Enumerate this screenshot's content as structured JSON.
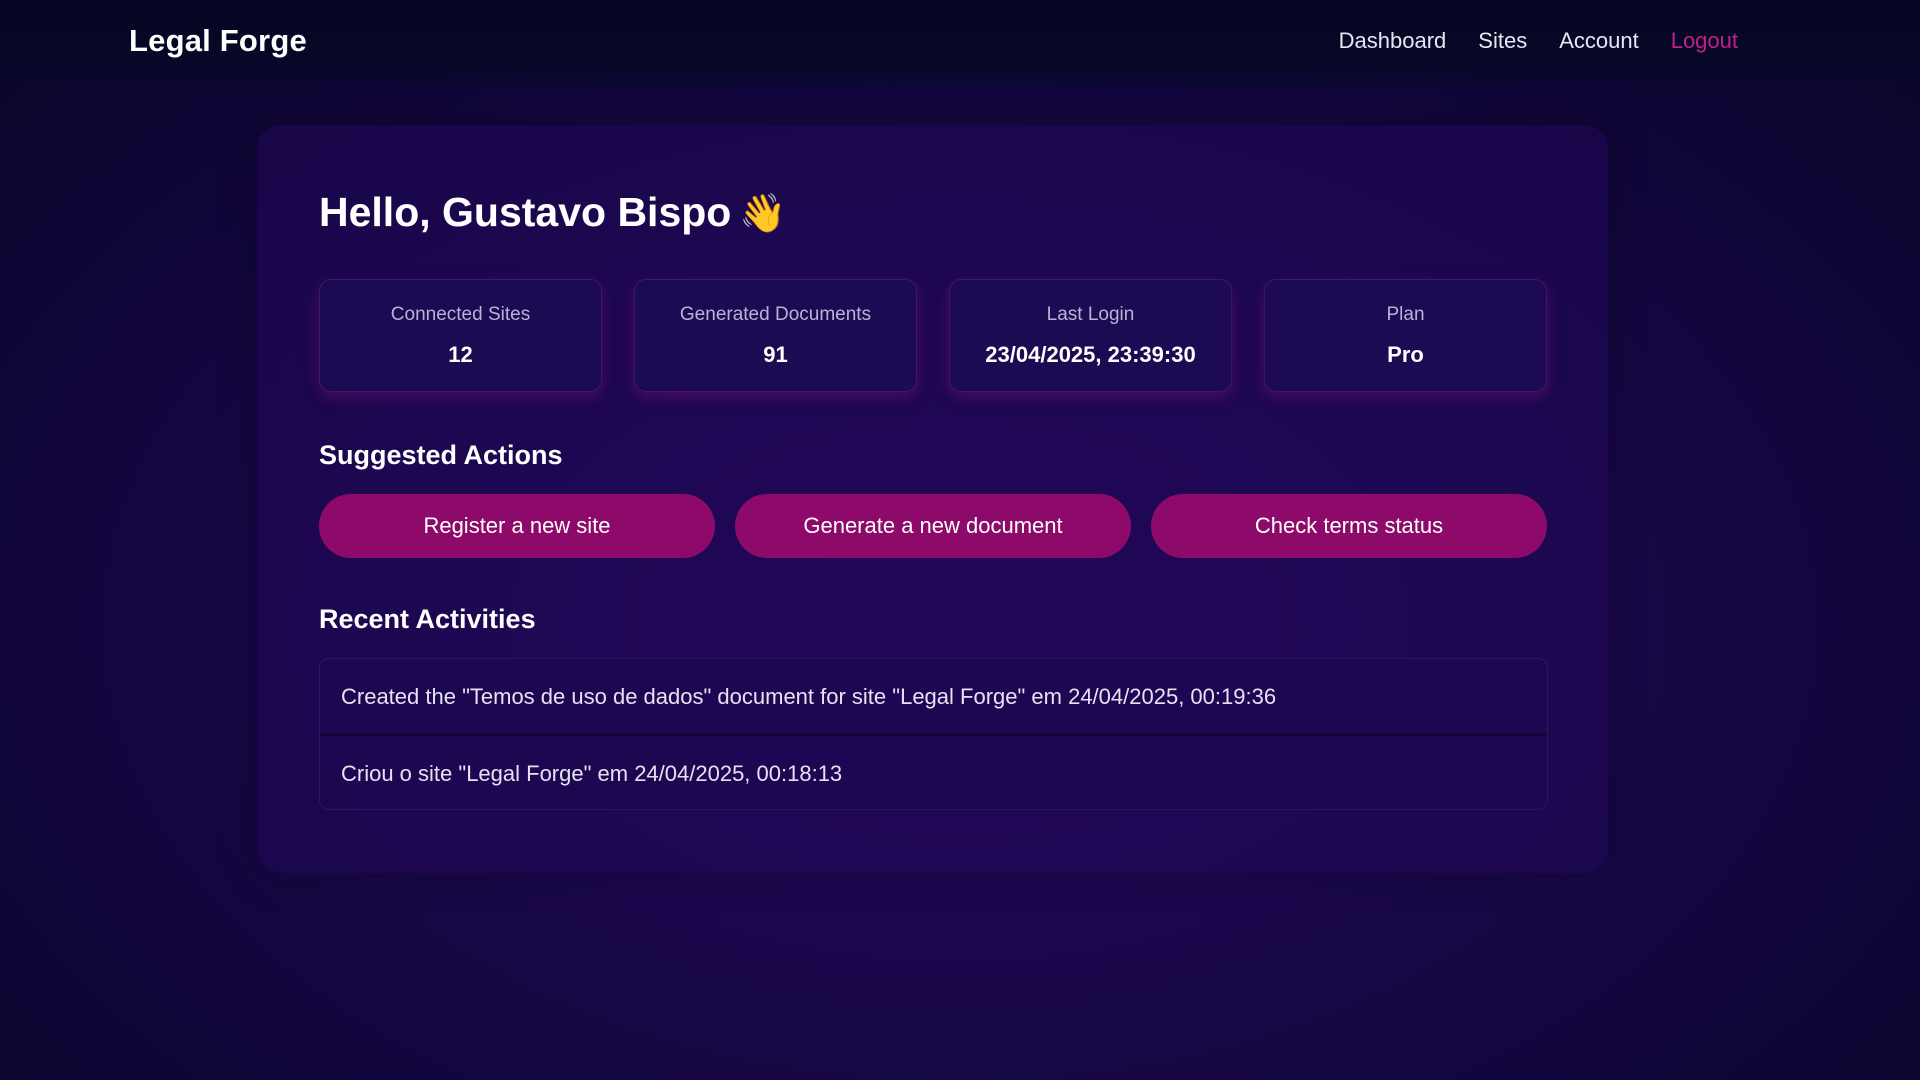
{
  "header": {
    "brand": "Legal Forge",
    "nav": {
      "dashboard": "Dashboard",
      "sites": "Sites",
      "account": "Account",
      "logout": "Logout"
    }
  },
  "main": {
    "greeting": "Hello, Gustavo Bispo",
    "greeting_emoji": "👋",
    "stats": [
      {
        "label": "Connected Sites",
        "value": "12"
      },
      {
        "label": "Generated Documents",
        "value": "91"
      },
      {
        "label": "Last Login",
        "value": "23/04/2025, 23:39:30"
      },
      {
        "label": "Plan",
        "value": "Pro"
      }
    ],
    "suggested_title": "Suggested Actions",
    "actions": [
      "Register a new site",
      "Generate a new document",
      "Check terms status"
    ],
    "recent_title": "Recent Activities",
    "activities": [
      "Created the \"Temos de uso de dados\" document for site \"Legal Forge\" em 24/04/2025, 00:19:36",
      "Criou o site \"Legal Forge\" em 24/04/2025, 00:18:13"
    ]
  },
  "colors": {
    "accent": "#8e0a6a",
    "logout": "#c0208c",
    "background": "#180748"
  }
}
